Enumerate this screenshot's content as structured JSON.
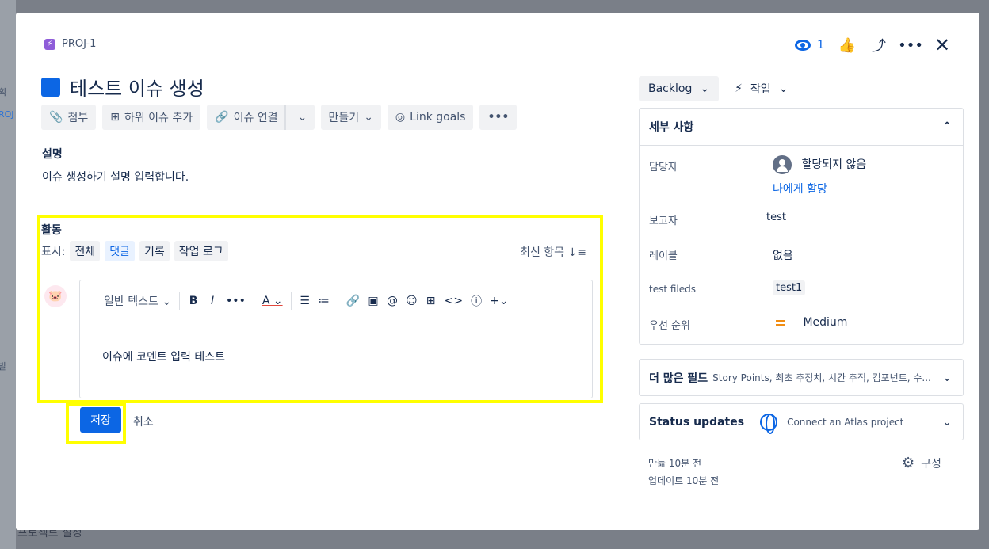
{
  "issue": {
    "key": "PROJ-1",
    "title": "테스트 이슈 생성",
    "watch_count": "1"
  },
  "toolbar": {
    "attach": "첨부",
    "add_child": "하위 이슈 추가",
    "link_issue": "이슈 연결",
    "create": "만들기",
    "link_goals": "Link goals"
  },
  "description": {
    "label": "설명",
    "text": "이슈 생성하기 설명 입력합니다."
  },
  "activity": {
    "label": "활동",
    "show_label": "표시:",
    "filters": [
      "전체",
      "댓글",
      "기록",
      "작업 로그"
    ],
    "active_filter": "댓글",
    "sort_label": "최신 항목"
  },
  "editor": {
    "text_style": "일반 텍스트",
    "content": "이슈에 코멘트 입력 테스트"
  },
  "buttons": {
    "save": "저장",
    "cancel": "취소"
  },
  "status": {
    "current": "Backlog",
    "action": "작업"
  },
  "details": {
    "header": "세부 사항",
    "assignee_label": "담당자",
    "assignee_value": "할당되지 않음",
    "assign_to_me": "나에게 할당",
    "reporter_label": "보고자",
    "reporter_value": "test",
    "labels_label": "레이블",
    "labels_value": "없음",
    "custom_label": "test fileds",
    "custom_value": "test1",
    "priority_label": "우선 순위",
    "priority_value": "Medium"
  },
  "more_fields": {
    "title": "더 많은 필드",
    "summary": "Story Points, 최초 추정치, 시간 추적, 컴포넌트, 수..."
  },
  "status_updates": {
    "title": "Status updates",
    "text": "Connect an Atlas project"
  },
  "meta": {
    "created": "만듦 10분 전",
    "updated": "업데이트 10분 전",
    "configure": "구성"
  },
  "background": {
    "settings_text": "프로젝트 설정"
  },
  "colors": {
    "accent": "#0c66e4",
    "highlight": "#ffff00",
    "priority": "#f18d13"
  }
}
